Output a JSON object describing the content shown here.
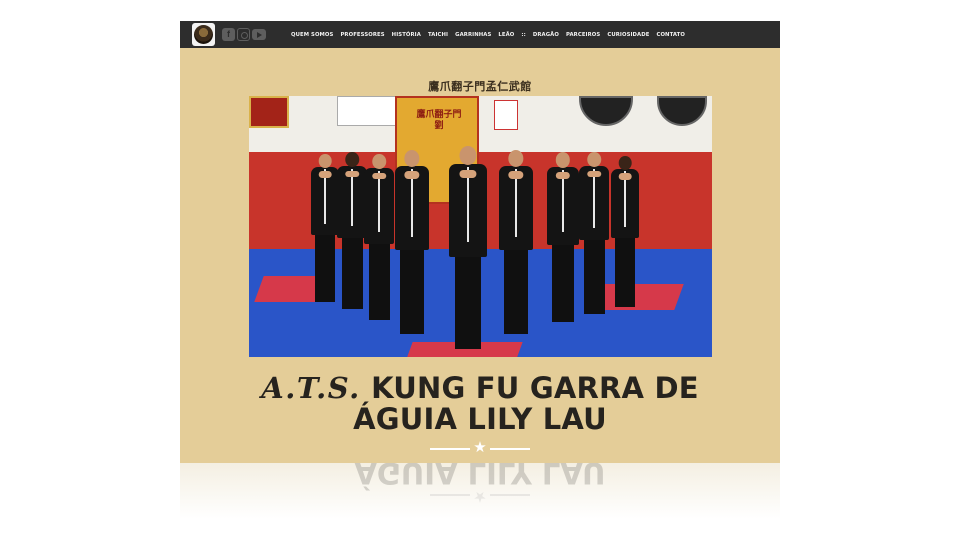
{
  "header": {
    "social": [
      {
        "icon": "facebook-icon",
        "glyph": "f"
      },
      {
        "icon": "instagram-icon",
        "glyph": ""
      },
      {
        "icon": "youtube-icon",
        "glyph": ""
      }
    ],
    "nav": [
      "QUEM SOMOS",
      "PROFESSORES",
      "HISTÓRIA",
      "TAICHI",
      "GARRINHAS",
      "LEÃO",
      "::",
      "DRAGÃO",
      "PARCEIROS",
      "CURIOSIDADE",
      "CONTATO"
    ]
  },
  "hero": {
    "chinese_title": "鷹爪翻子門孟仁武館",
    "banner_text": "鷹爪翻子門 劉"
  },
  "title": {
    "brush_part": "A.T.S.",
    "line1_rest": "KUNG FU GARRA DE",
    "line2": "ÁGUIA LILY LAU"
  },
  "divider": {
    "star": "★"
  },
  "colors": {
    "page_bg": "#e4cd98",
    "topbar": "#2d2d2d",
    "title": "#26231e",
    "divider": "#ffffff"
  }
}
